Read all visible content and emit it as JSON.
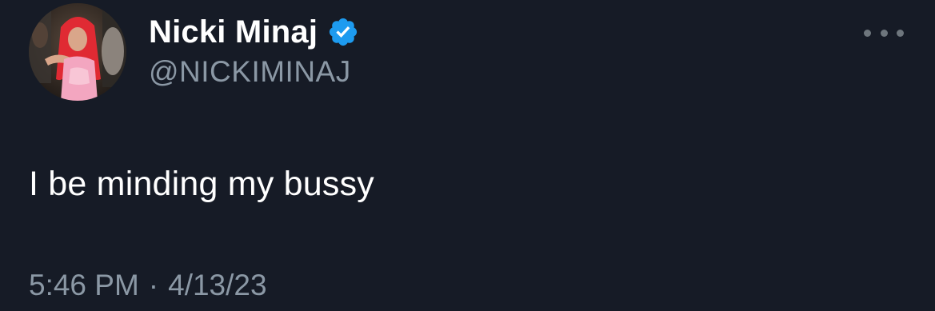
{
  "tweet": {
    "author": {
      "display_name": "Nicki Minaj",
      "handle": "@NICKIMINAJ",
      "verified": true,
      "verified_color": "#1d9bf0",
      "avatar_description": "profile photo"
    },
    "text": "I be minding my bussy",
    "time": "5:46 PM",
    "separator": "·",
    "date": "4/13/23",
    "more_icon": "more-horizontal-icon"
  },
  "colors": {
    "background": "#161b26",
    "primary_text": "#ffffff",
    "secondary_text": "#8b98a5"
  }
}
